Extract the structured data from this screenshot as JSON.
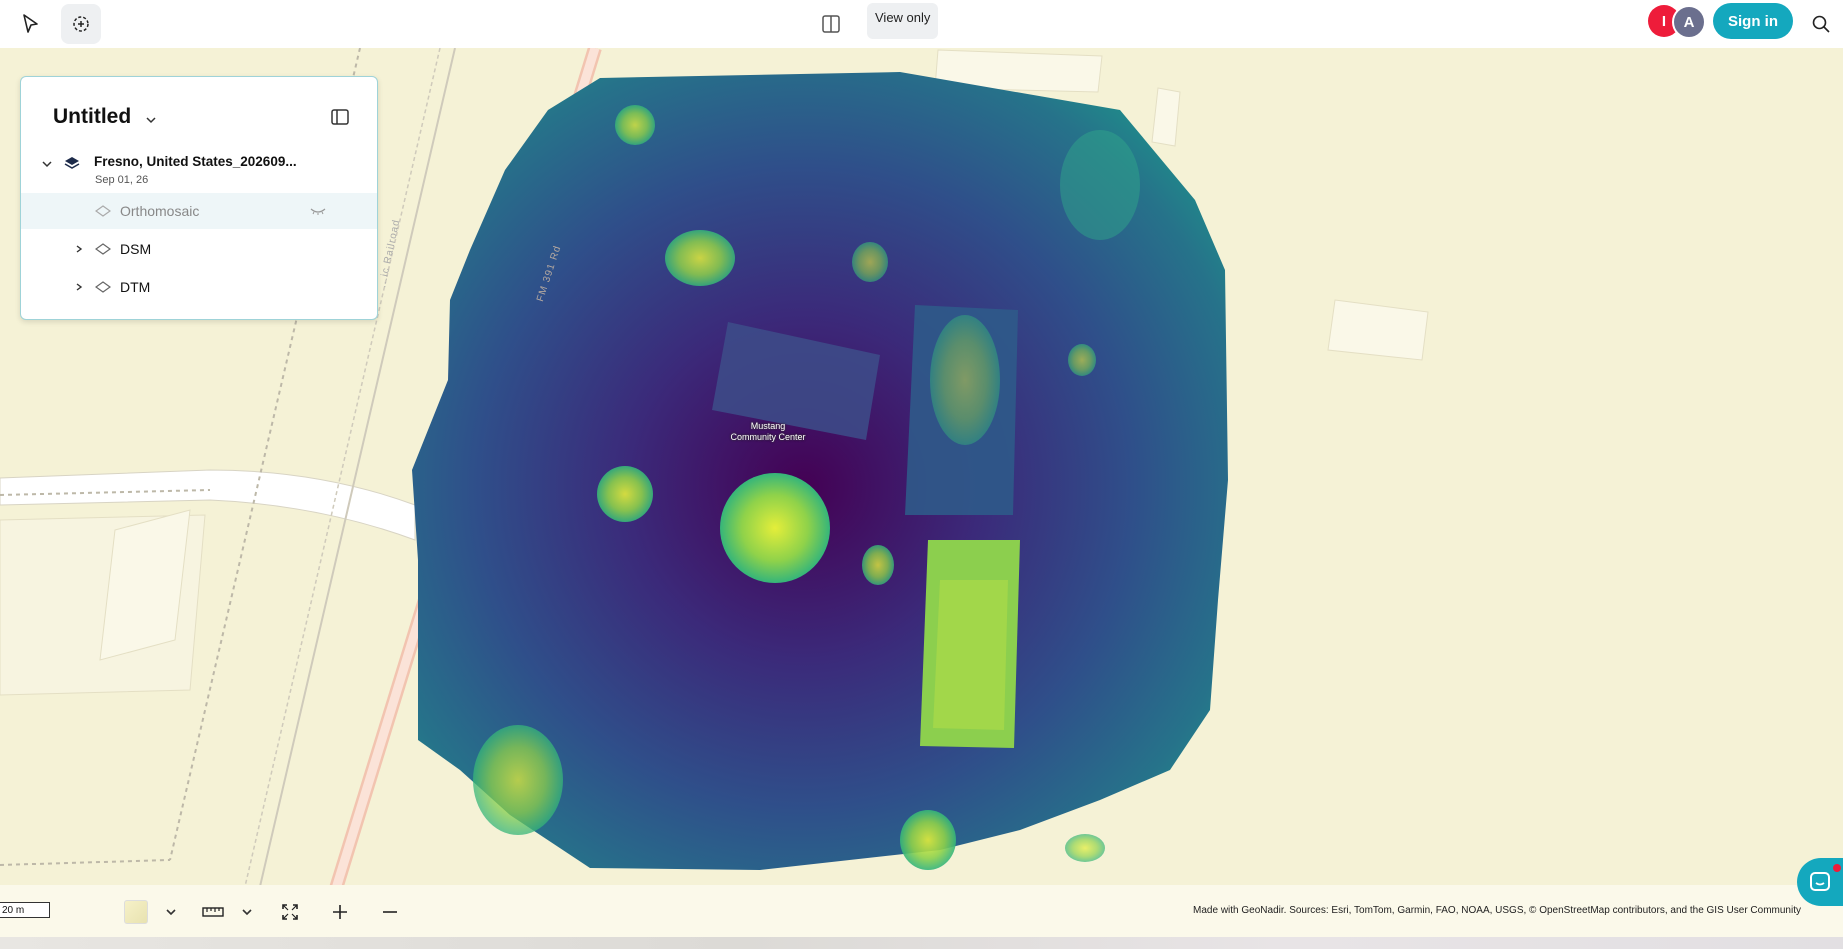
{
  "topbar": {
    "view_mode": "View only",
    "avatars": [
      {
        "initial": "I",
        "color": "#ee1c3a"
      },
      {
        "initial": "A",
        "color": "#6b6f8e"
      }
    ],
    "signin_label": "Sign in",
    "icons": [
      "cursor-icon",
      "target-icon",
      "split-view-icon",
      "search-icon"
    ]
  },
  "panel": {
    "title": "Untitled",
    "project": {
      "name": "Fresno, United States_202609...",
      "date": "Sep 01, 26"
    },
    "layers": [
      {
        "label": "Orthomosaic",
        "expandable": false,
        "hidden": true
      },
      {
        "label": "DSM",
        "expandable": true,
        "hidden": false
      },
      {
        "label": "DTM",
        "expandable": true,
        "hidden": false
      }
    ]
  },
  "map": {
    "place_label": "Mustang Community Center",
    "road_labels": [
      "FM 391 Rd",
      "...ic Railroad"
    ]
  },
  "bottombar": {
    "scale": "20 m",
    "attribution": "Made with GeoNadir. Sources: Esri, TomTom, Garmin, FAO, NOAA, USGS, © OpenStreetMap contributors, and the GIS User Community"
  },
  "colors": {
    "accent": "#14a8be",
    "viridis_dark": "#440154",
    "viridis_mid": "#2d6e8e",
    "viridis_light": "#c8e020"
  }
}
